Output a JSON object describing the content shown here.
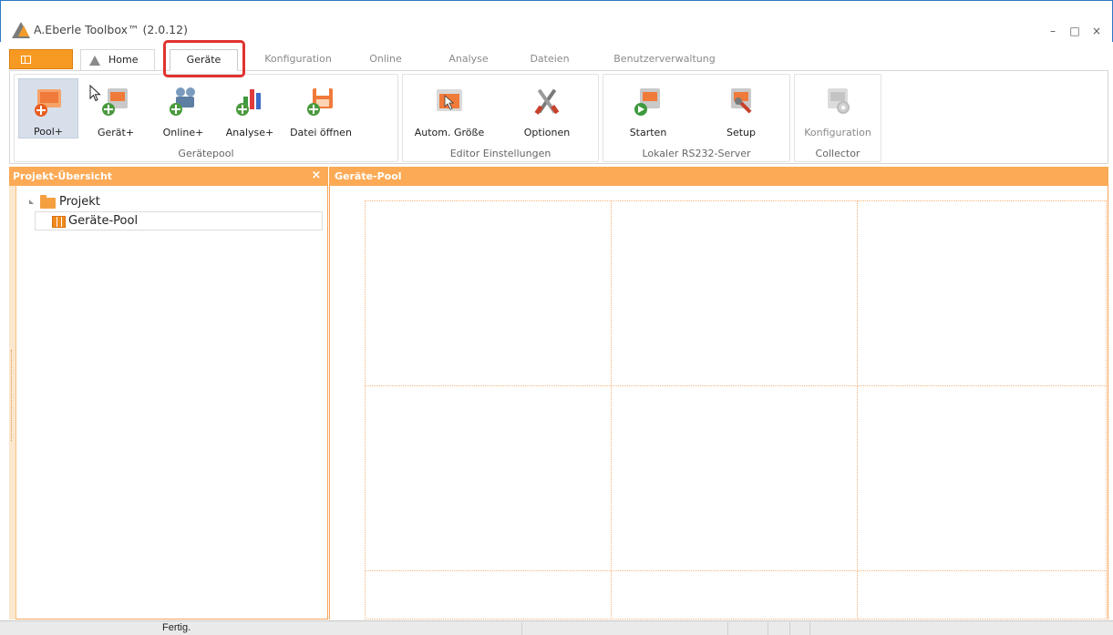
{
  "window": {
    "title": "A.Eberle Toolbox™ (2.0.12)",
    "controls": [
      "–",
      "□",
      "×"
    ]
  },
  "tabs": {
    "home": "Home",
    "active": "Geräte",
    "others": [
      "Konfiguration",
      "Online",
      "Analyse",
      "Dateien",
      "Benutzerverwaltung"
    ]
  },
  "ribbon": {
    "groups": [
      {
        "title": "Gerätepool",
        "buttons": [
          "Pool+",
          "Gerät+",
          "Online+",
          "Analyse+",
          "Datei öffnen"
        ]
      },
      {
        "title": "Editor Einstellungen",
        "buttons": [
          "Autom. Größe",
          "Optionen"
        ]
      },
      {
        "title": "Lokaler RS232-Server",
        "buttons": [
          "Starten",
          "Setup"
        ]
      },
      {
        "title": "Collector",
        "buttons": [
          "Konfiguration"
        ]
      }
    ]
  },
  "left_panel": {
    "title": "Projekt-Übersicht",
    "close": "×",
    "tree": {
      "root": "Projekt",
      "child": "Geräte-Pool"
    }
  },
  "main": {
    "title": "Geräte-Pool"
  },
  "status": {
    "text": "Fertig."
  },
  "colors": {
    "accent_orange": "#fcaa55",
    "highlight_red": "#e0322f",
    "title_border": "#2b78c6"
  }
}
